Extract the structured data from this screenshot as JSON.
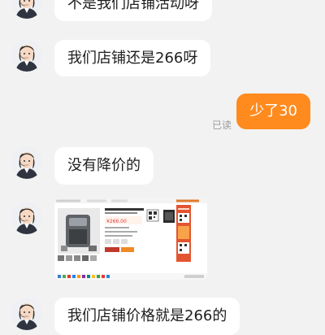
{
  "messages": [
    {
      "direction": "in",
      "type": "text",
      "text": "不是我们店铺活动呀"
    },
    {
      "direction": "in",
      "type": "text",
      "text": "我们店铺还是266呀"
    },
    {
      "direction": "out",
      "type": "text",
      "text": "少了30",
      "status": "已读"
    },
    {
      "direction": "in",
      "type": "text",
      "text": "没有降价的"
    },
    {
      "direction": "in",
      "type": "image",
      "text": "",
      "image_price": "¥266.00"
    },
    {
      "direction": "in",
      "type": "text",
      "text": "我们店铺价格就是266的"
    }
  ],
  "colors": {
    "background": "#f2f2f2",
    "incoming_bubble": "#ffffff",
    "outgoing_bubble": "#ff8a1d",
    "read_status": "#9a9a9a"
  },
  "icons": {
    "avatar": "agent-avatar-icon"
  }
}
